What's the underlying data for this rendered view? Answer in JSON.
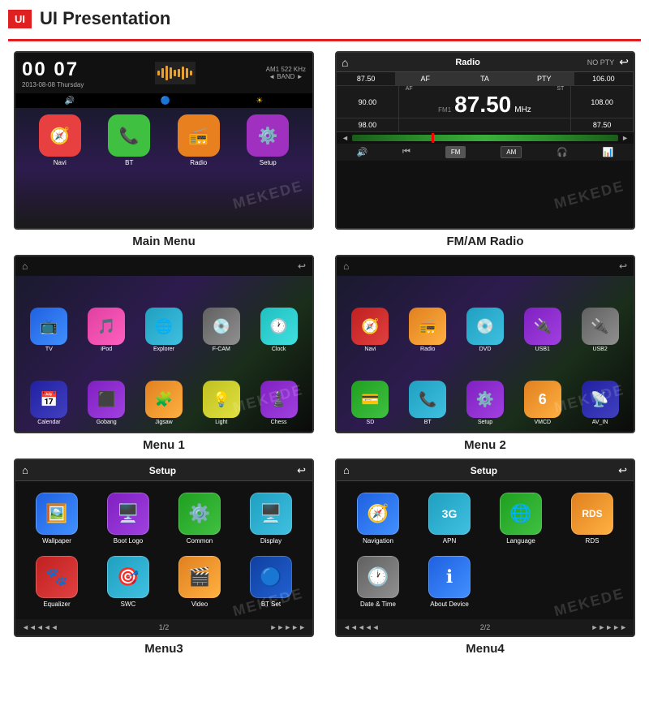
{
  "header": {
    "badge": "UI",
    "title": "UI Presentation"
  },
  "screens": {
    "main_menu": {
      "caption": "Main Menu",
      "clock": "00 07",
      "date": "2013-08-08 Thursday",
      "radio_info": "AM1 522 KHz",
      "band_label": "BAND",
      "apps": [
        {
          "label": "Navi",
          "icon": "🧭"
        },
        {
          "label": "BT",
          "icon": "📞"
        },
        {
          "label": "Radio",
          "icon": "📻"
        },
        {
          "label": "Setup",
          "icon": "⚙️"
        }
      ]
    },
    "fm_am_radio": {
      "caption": "FM/AM Radio",
      "title": "Radio",
      "no_pty": "NO PTY",
      "freq_87_50": "87.50",
      "af": "AF",
      "ta": "TA",
      "pty": "PTY",
      "freq_106": "106.00",
      "freq_90": "90.00",
      "af_label": "AF",
      "st_label": "ST",
      "fm1_label": "FM1",
      "freq_main": "87.50",
      "mhz": "MHz",
      "freq_108": "108.00",
      "freq_98": "98.00",
      "freq_87_50_b": "87.50",
      "freq_108_b": "108.00",
      "fm_btn": "FM",
      "am_btn": "AM"
    },
    "menu1": {
      "caption": "Menu 1",
      "apps": [
        {
          "label": "TV",
          "icon": "📺"
        },
        {
          "label": "iPod",
          "icon": "🎵"
        },
        {
          "label": "Explorer",
          "icon": "🌐"
        },
        {
          "label": "F-CAM",
          "icon": "💿"
        },
        {
          "label": "Clock",
          "icon": "🕐"
        },
        {
          "label": "Calendar",
          "icon": "📅"
        },
        {
          "label": "Gobang",
          "icon": "⬛"
        },
        {
          "label": "Jigsaw",
          "icon": "🧩"
        },
        {
          "label": "Light",
          "icon": "💡"
        },
        {
          "label": "Chess",
          "icon": "♟️"
        }
      ]
    },
    "menu2": {
      "caption": "Menu 2",
      "apps": [
        {
          "label": "Navi",
          "icon": "🧭"
        },
        {
          "label": "Radio",
          "icon": "📻"
        },
        {
          "label": "DVD",
          "icon": "💿"
        },
        {
          "label": "USB1",
          "icon": "🔌"
        },
        {
          "label": "USB2",
          "icon": "🔌"
        },
        {
          "label": "SD",
          "icon": "💳"
        },
        {
          "label": "BT",
          "icon": "📞"
        },
        {
          "label": "Setup",
          "icon": "⚙️"
        },
        {
          "label": "VMCD",
          "icon": "6"
        },
        {
          "label": "AV_IN",
          "icon": "📡"
        }
      ]
    },
    "menu3": {
      "caption": "Menu3",
      "title": "Setup",
      "page": "1/2",
      "apps": [
        {
          "label": "Wallpaper",
          "icon": "🖼️"
        },
        {
          "label": "Boot Logo",
          "icon": "🖥️"
        },
        {
          "label": "Common",
          "icon": "⚙️"
        },
        {
          "label": "Display",
          "icon": "🖥️"
        },
        {
          "label": "Equalizer",
          "icon": "🐾"
        },
        {
          "label": "SWC",
          "icon": "🎯"
        },
        {
          "label": "Video",
          "icon": "🎬"
        },
        {
          "label": "BT Set",
          "icon": "🔵"
        }
      ]
    },
    "menu4": {
      "caption": "Menu4",
      "title": "Setup",
      "page": "2/2",
      "apps": [
        {
          "label": "Navigation",
          "icon": "🧭"
        },
        {
          "label": "APN",
          "icon": "3G"
        },
        {
          "label": "Language",
          "icon": "🌐"
        },
        {
          "label": "RDS",
          "icon": "RDS"
        },
        {
          "label": "Date & Time",
          "icon": "🕐"
        },
        {
          "label": "About Device",
          "icon": "ℹ️"
        }
      ]
    }
  },
  "watermark": "MEKEDE"
}
